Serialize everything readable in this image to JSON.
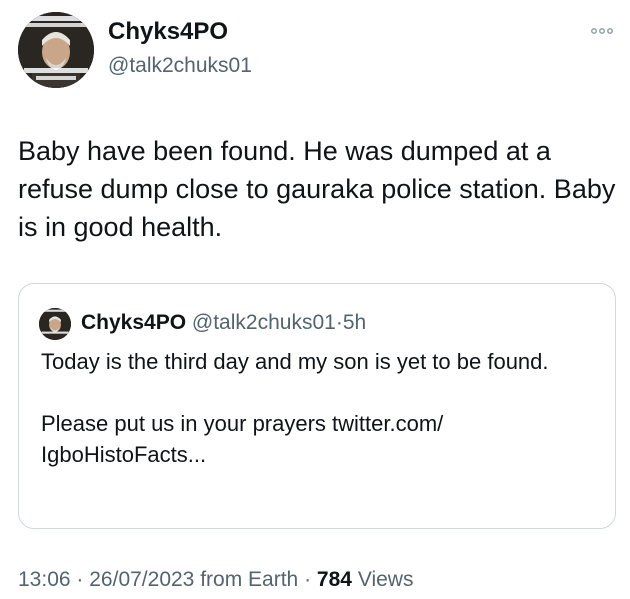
{
  "author": {
    "name": "Chyks4PO",
    "handle": "@talk2chuks01",
    "avatar_icon": "meme-avatar-icon"
  },
  "tweet": {
    "text": "Baby have been found. He was dumped at a refuse dump close to gauraka police station. Baby is in good health."
  },
  "quoted_tweet": {
    "name": "Chyks4PO",
    "handle": "@talk2chuks01",
    "separator": "·",
    "time_ago": "5h",
    "paragraphs": [
      "Today is the third day and my son is yet to be found.",
      "Please put us in your prayers twitter.com/ IgboHistoFacts..."
    ]
  },
  "meta": {
    "time": "13:06",
    "separator": "·",
    "date": "26/07/2023",
    "source": "from Earth",
    "views_count": "784",
    "views_label": "Views"
  },
  "colors": {
    "text_primary": "#0f1419",
    "text_secondary": "#536471",
    "border": "#cfd9de"
  },
  "icons": {
    "more": "more-horizontal-icon"
  }
}
